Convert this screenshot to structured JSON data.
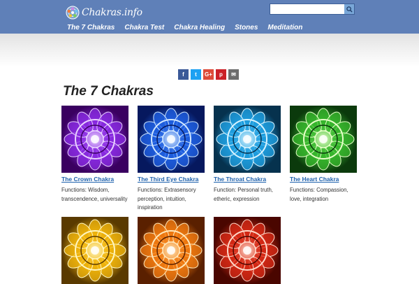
{
  "header": {
    "logo_text": "Chakras.info",
    "search": {
      "placeholder": "",
      "button_icon": "search-icon"
    }
  },
  "nav": [
    "The 7 Chakras",
    "Chakra Test",
    "Chakra Healing",
    "Stones",
    "Meditation"
  ],
  "share": [
    {
      "icon": "facebook-icon",
      "glyph": "f",
      "color": "#3b5998"
    },
    {
      "icon": "twitter-icon",
      "glyph": "t",
      "color": "#1da1f2"
    },
    {
      "icon": "google-plus-icon",
      "glyph": "G+",
      "color": "#dd4b39"
    },
    {
      "icon": "pinterest-icon",
      "glyph": "p",
      "color": "#cb2027"
    },
    {
      "icon": "email-icon",
      "glyph": "✉",
      "color": "#6d6d6d"
    }
  ],
  "page_title": "The 7 Chakras",
  "chakras": [
    {
      "title": "The Crown Chakra",
      "functions": "Functions: Wisdom, transcendence, universality",
      "image_colors": [
        "#e8d0ff",
        "#8a2be2",
        "#3a0060"
      ]
    },
    {
      "title": "The Third Eye Chakra",
      "functions": "Functions: Extrasensory perception, intuition, inspiration",
      "image_colors": [
        "#cfe6ff",
        "#1f5fe0",
        "#06185e"
      ]
    },
    {
      "title": "The Throat Chakra",
      "functions": "Function: Personal truth, etheric, expression",
      "image_colors": [
        "#d8f4ff",
        "#1f9fe0",
        "#06324e"
      ]
    },
    {
      "title": "The Heart Chakra",
      "functions": "Functions: Compassion, love, integration",
      "image_colors": [
        "#e5ffc7",
        "#38b82e",
        "#0b3a0c"
      ]
    },
    {
      "title": "",
      "functions": "",
      "image_colors": [
        "#fff6c0",
        "#f0b40c",
        "#5a3a00"
      ]
    },
    {
      "title": "",
      "functions": "",
      "image_colors": [
        "#ffe6b8",
        "#f07a10",
        "#5a2000"
      ]
    },
    {
      "title": "",
      "functions": "",
      "image_colors": [
        "#ffd7c8",
        "#d62a16",
        "#4a0600"
      ]
    }
  ]
}
